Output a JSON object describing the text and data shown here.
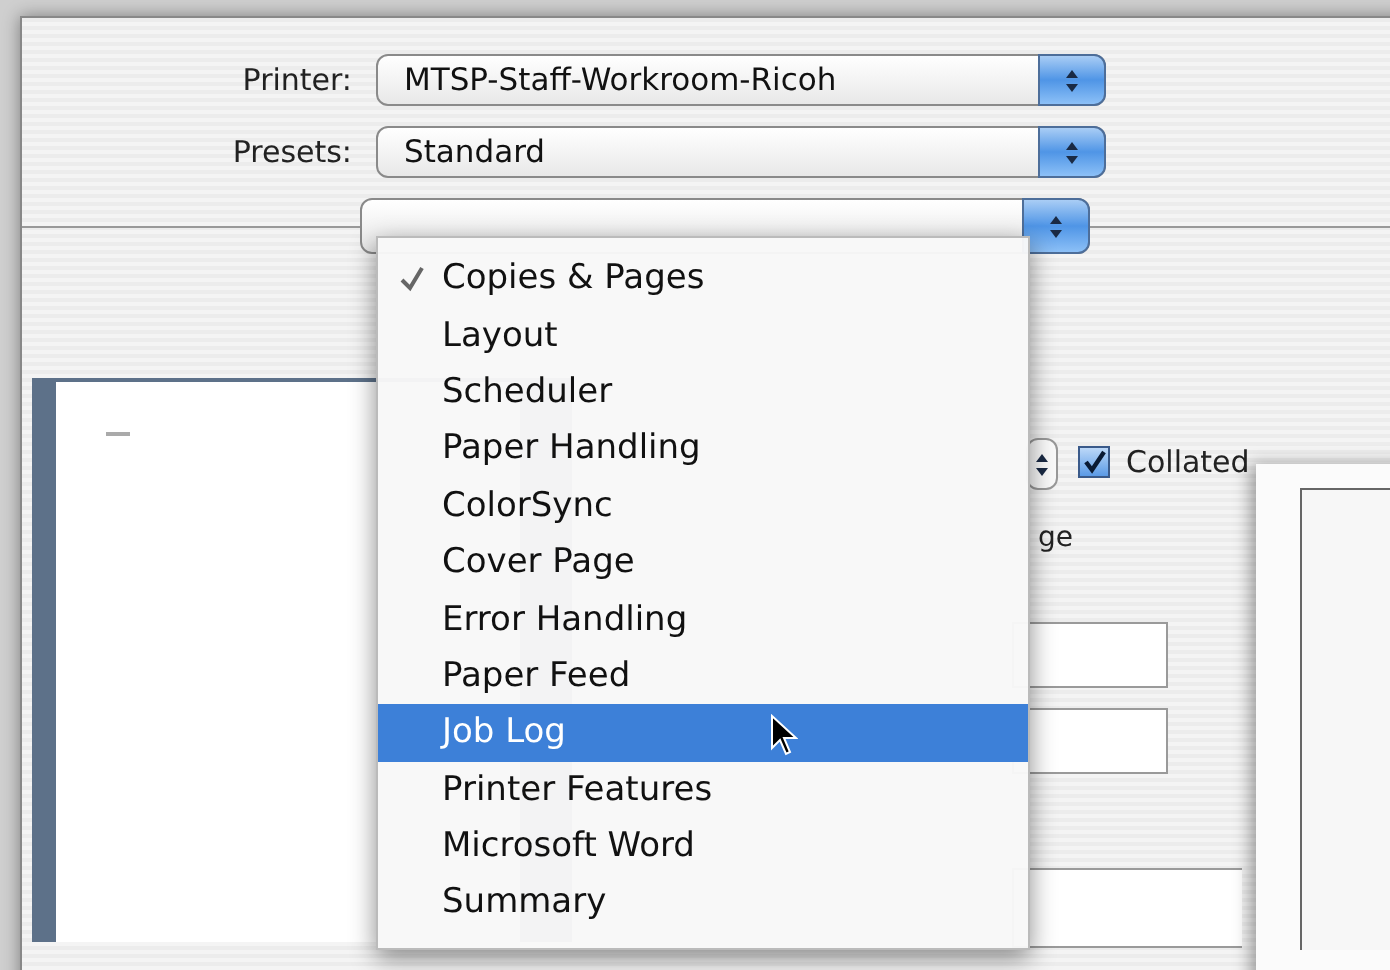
{
  "printer": {
    "label": "Printer:",
    "value": "MTSP-Staff-Workroom-Ricoh"
  },
  "presets": {
    "label": "Presets:",
    "value": "Standard"
  },
  "panel_menu": {
    "items": [
      {
        "label": "Copies & Pages",
        "checked": true,
        "selected": false
      },
      {
        "label": "Layout",
        "checked": false,
        "selected": false
      },
      {
        "label": "Scheduler",
        "checked": false,
        "selected": false
      },
      {
        "label": "Paper Handling",
        "checked": false,
        "selected": false
      },
      {
        "label": "ColorSync",
        "checked": false,
        "selected": false
      },
      {
        "label": "Cover Page",
        "checked": false,
        "selected": false
      },
      {
        "label": "Error Handling",
        "checked": false,
        "selected": false
      },
      {
        "label": "Paper Feed",
        "checked": false,
        "selected": false
      },
      {
        "label": "Job Log",
        "checked": false,
        "selected": true
      },
      {
        "label": "Printer Features",
        "checked": false,
        "selected": false
      },
      {
        "label": "Microsoft Word",
        "checked": false,
        "selected": false
      },
      {
        "label": "Summary",
        "checked": false,
        "selected": false
      }
    ]
  },
  "collated": {
    "label": "Collated",
    "checked": true
  },
  "pages": {
    "partial_label": "ge"
  }
}
